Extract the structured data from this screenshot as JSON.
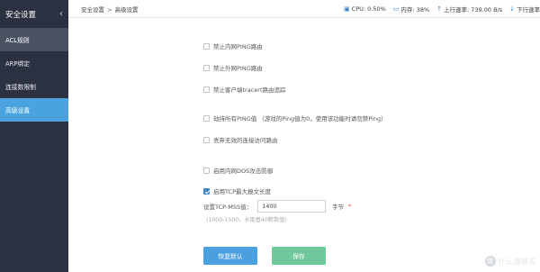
{
  "sidebar": {
    "title": "安全设置",
    "collapse_icon": "chevron-left-icon",
    "items": [
      {
        "label": "ACL规则"
      },
      {
        "label": "ARP绑定"
      },
      {
        "label": "连接数限制"
      },
      {
        "label": "高级设置"
      }
    ]
  },
  "breadcrumb": {
    "parent": "安全设置",
    "separator": ">",
    "current": "高级设置"
  },
  "status": {
    "cpu": "CPU: 0.50%",
    "memory": "内存: 38%",
    "upload": "上行速率: 739.00 B/s",
    "download": "下行速率"
  },
  "options": [
    {
      "label": "禁止内网PING路由",
      "checked": false
    },
    {
      "label": "禁止外网PING路由",
      "checked": false
    },
    {
      "label": "禁止客户端tracert路由追踪",
      "checked": false
    },
    {
      "label": "劫持所有PING值 （游戏的Ping值为0，使用该功能时请勿禁Ping）",
      "checked": false
    },
    {
      "label": "丢弃无效的连接访问路由",
      "checked": false
    },
    {
      "label": "启用内网DOS攻击防御",
      "checked": false
    },
    {
      "label": "启用TCP最大报文长度",
      "checked": true
    }
  ],
  "mss": {
    "label": "设置TCP-MSS值：",
    "value": "1400",
    "unit": "字节",
    "required_mark": "*",
    "hint": "(1000-1500，长度基40默数值)"
  },
  "buttons": {
    "reset": "恢复默认",
    "save": "保存"
  },
  "watermark": {
    "badge": "值",
    "text": "什么值得买"
  },
  "colors": {
    "sidebar_bg": "#2b3140",
    "active_item": "#4aa3df",
    "primary_button": "#4a9fdf",
    "save_button": "#6fc99b",
    "checkbox_checked": "#3d87c7"
  }
}
